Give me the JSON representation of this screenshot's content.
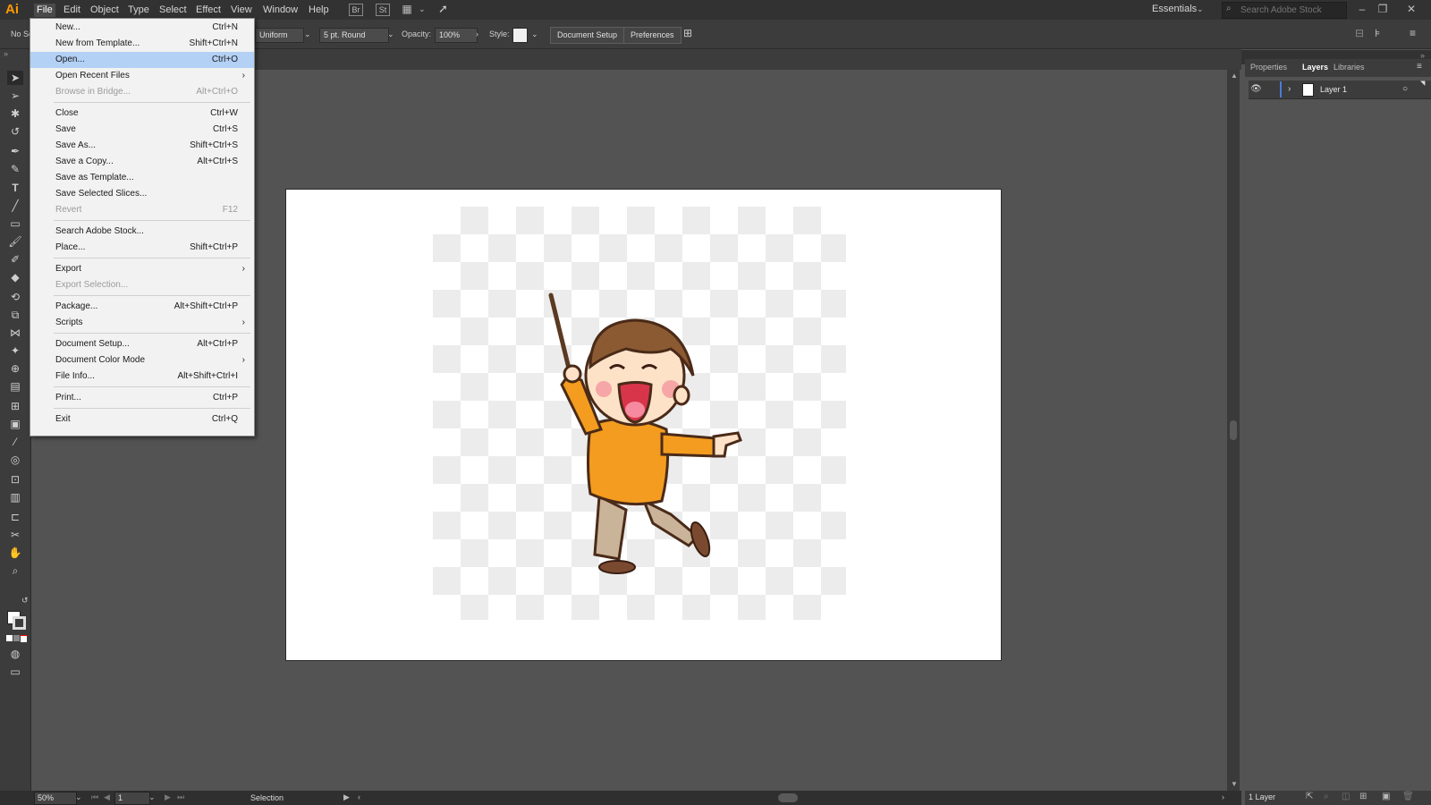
{
  "app": {
    "logo": "Ai"
  },
  "menubar": {
    "items": [
      "File",
      "Edit",
      "Object",
      "Type",
      "Select",
      "Effect",
      "View",
      "Window",
      "Help"
    ],
    "workspace": "Essentials",
    "search_placeholder": "Search Adobe Stock",
    "bridge_icon": "Br",
    "stock_icon": "St"
  },
  "controlbar": {
    "no_selection": "No Se",
    "uniform": "Uniform",
    "brush": "5 pt. Round",
    "opacity_label": "Opacity:",
    "opacity": "100%",
    "style_label": "Style:",
    "document_setup": "Document Setup",
    "preferences": "Preferences"
  },
  "file_menu": [
    {
      "label": "New...",
      "shortcut": "Ctrl+N"
    },
    {
      "label": "New from Template...",
      "shortcut": "Shift+Ctrl+N"
    },
    {
      "label": "Open...",
      "shortcut": "Ctrl+O",
      "highlight": true
    },
    {
      "label": "Open Recent Files",
      "submenu": true
    },
    {
      "label": "Browse in Bridge...",
      "shortcut": "Alt+Ctrl+O",
      "disabled": true
    },
    {
      "label": "Close",
      "shortcut": "Ctrl+W"
    },
    {
      "label": "Save",
      "shortcut": "Ctrl+S"
    },
    {
      "label": "Save As...",
      "shortcut": "Shift+Ctrl+S"
    },
    {
      "label": "Save a Copy...",
      "shortcut": "Alt+Ctrl+S"
    },
    {
      "label": "Save as Template..."
    },
    {
      "label": "Save Selected Slices..."
    },
    {
      "label": "Revert",
      "shortcut": "F12",
      "disabled": true
    },
    {
      "label": "Search Adobe Stock..."
    },
    {
      "label": "Place...",
      "shortcut": "Shift+Ctrl+P"
    },
    {
      "label": "Export",
      "submenu": true
    },
    {
      "label": "Export Selection...",
      "disabled": true
    },
    {
      "label": "Package...",
      "shortcut": "Alt+Shift+Ctrl+P"
    },
    {
      "label": "Scripts",
      "submenu": true
    },
    {
      "label": "Document Setup...",
      "shortcut": "Alt+Ctrl+P"
    },
    {
      "label": "Document Color Mode",
      "submenu": true
    },
    {
      "label": "File Info...",
      "shortcut": "Alt+Shift+Ctrl+I"
    },
    {
      "label": "Print...",
      "shortcut": "Ctrl+P"
    },
    {
      "label": "Exit",
      "shortcut": "Ctrl+Q"
    }
  ],
  "panel": {
    "tabs": [
      "Properties",
      "Layers",
      "Libraries"
    ],
    "active_tab": "Layers",
    "layer_name": "Layer 1",
    "layer_count": "1 Layer"
  },
  "status": {
    "zoom": "50%",
    "artboard": "1",
    "tool": "Selection"
  },
  "colors": {
    "menu_highlight": "#b3d0f5",
    "logo": "#ff9a00"
  }
}
